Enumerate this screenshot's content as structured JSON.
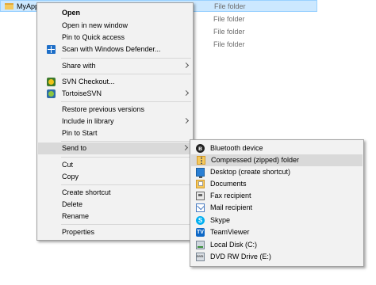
{
  "explorer": {
    "selected_file": "MyApplic",
    "type_label": "File folder"
  },
  "context_menu": {
    "open": "Open",
    "open_new_window": "Open in new window",
    "pin_quick_access": "Pin to Quick access",
    "scan_defender": "Scan with Windows Defender...",
    "share_with": "Share with",
    "svn_checkout": "SVN Checkout...",
    "tortoise_svn": "TortoiseSVN",
    "restore_versions": "Restore previous versions",
    "include_library": "Include in library",
    "pin_start": "Pin to Start",
    "send_to": "Send to",
    "cut": "Cut",
    "copy": "Copy",
    "create_shortcut": "Create shortcut",
    "delete": "Delete",
    "rename": "Rename",
    "properties": "Properties"
  },
  "send_to_menu": {
    "bluetooth": "Bluetooth device",
    "compressed": "Compressed (zipped) folder",
    "desktop": "Desktop (create shortcut)",
    "documents": "Documents",
    "fax": "Fax recipient",
    "mail": "Mail recipient",
    "skype": "Skype",
    "teamviewer": "TeamViewer",
    "local_disk": "Local Disk (C:)",
    "dvd": "DVD RW Drive (E:)"
  },
  "icons": {
    "bluetooth_glyph": "ʙ",
    "skype_glyph": "S",
    "teamviewer_glyph": "TV"
  },
  "colors": {
    "selection_bg": "#cce8ff",
    "menu_bg": "#f2f2f2",
    "hover_bg": "#d9d9d9"
  }
}
